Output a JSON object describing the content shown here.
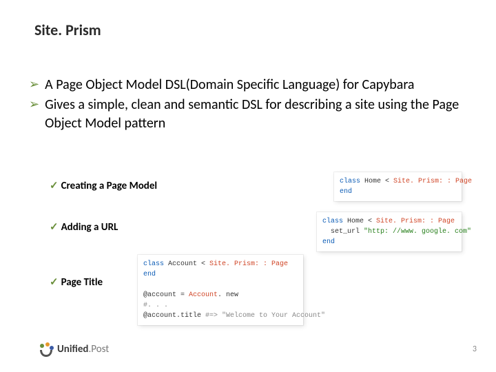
{
  "title": "Site. Prism",
  "bullets": [
    "A Page Object Model DSL(Domain Specific Language) for Capybara",
    "Gives a simple, clean and semantic DSL for describing a site using the Page Object Model pattern"
  ],
  "subpoints": {
    "creating": "Creating a Page Model",
    "adding_url": "Adding a URL",
    "page_title": "Page Title"
  },
  "code": {
    "snippet1": {
      "l1_a": "class",
      "l1_b": " Home < ",
      "l1_c": "Site. Prism: : Page",
      "l2": "end"
    },
    "snippet2": {
      "l1_a": "class",
      "l1_b": " Home < ",
      "l1_c": "Site. Prism: : Page",
      "l2_a": "  set_url ",
      "l2_b": "\"http: //www. google. com\"",
      "l3": "end"
    },
    "snippet3": {
      "l1_a": "class",
      "l1_b": " Account < ",
      "l1_c": "Site. Prism: : Page",
      "l2": "end",
      "l4_a": "@account = ",
      "l4_b": "Account",
      "l4_c": ". new",
      "l5": "#. . .",
      "l6_a": "@account.title ",
      "l6_b": "#=> \"Welcome to Your Account\""
    }
  },
  "footer": {
    "brand_bold": "Unified",
    "brand_light": ".Post"
  },
  "page_number": "3"
}
